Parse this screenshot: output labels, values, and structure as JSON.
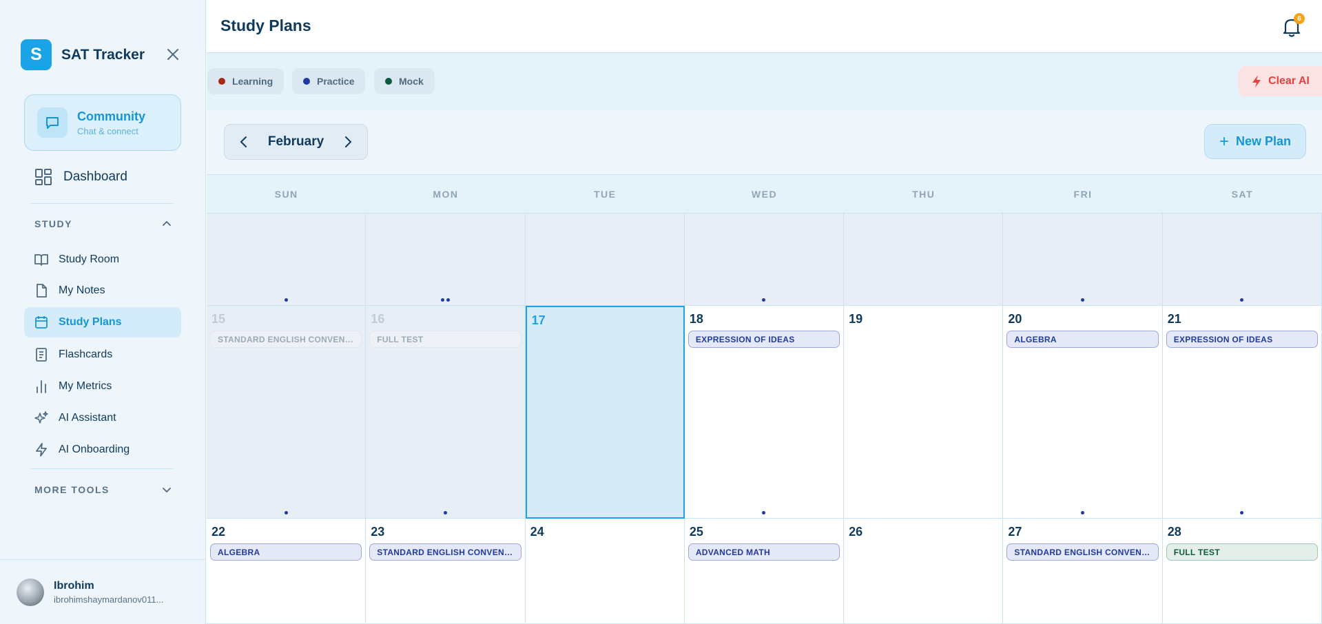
{
  "app": {
    "logo_letter": "S",
    "name": "SAT Tracker"
  },
  "sidebar": {
    "community": {
      "title": "Community",
      "subtitle": "Chat & connect"
    },
    "dashboard": "Dashboard",
    "study_section": "STUDY",
    "items": [
      {
        "label": "Study Room",
        "icon": "book-open-icon"
      },
      {
        "label": "My Notes",
        "icon": "file-icon"
      },
      {
        "label": "Study Plans",
        "icon": "calendar-icon",
        "active": true
      },
      {
        "label": "Flashcards",
        "icon": "notebook-icon"
      },
      {
        "label": "My Metrics",
        "icon": "bar-chart-icon"
      },
      {
        "label": "AI Assistant",
        "icon": "sparkles-icon"
      },
      {
        "label": "AI Onboarding",
        "icon": "lightning-icon"
      }
    ],
    "more_tools": "MORE TOOLS"
  },
  "user": {
    "name": "Ibrohim",
    "email": "ibrohimshaymardanov011..."
  },
  "header": {
    "title": "Study Plans",
    "notification_count": "6"
  },
  "legend": [
    {
      "label": "Learning",
      "color": "#a52a14"
    },
    {
      "label": "Practice",
      "color": "#1f3aa3"
    },
    {
      "label": "Mock",
      "color": "#0e5a3c"
    }
  ],
  "clear_ai": "Clear AI",
  "calendar": {
    "month": "February",
    "new_plan": "New Plan",
    "weekdays": [
      "SUN",
      "MON",
      "TUE",
      "WED",
      "THU",
      "FRI",
      "SAT"
    ],
    "weeks": [
      [
        {
          "day": "",
          "past": true,
          "dots": 1
        },
        {
          "day": "",
          "past": true,
          "dots": 2
        },
        {
          "day": "",
          "past": true,
          "dots": 0
        },
        {
          "day": "",
          "past": true,
          "dots": 1
        },
        {
          "day": "",
          "past": true,
          "dots": 0
        },
        {
          "day": "",
          "past": true,
          "dots": 1
        },
        {
          "day": "",
          "past": true,
          "dots": 1
        }
      ],
      [
        {
          "day": "15",
          "past": true,
          "event": "STANDARD ENGLISH CONVENTIONS",
          "type": "practice",
          "dots": 1
        },
        {
          "day": "16",
          "past": true,
          "event": "FULL TEST",
          "type": "mock",
          "dots": 1
        },
        {
          "day": "17",
          "today": true,
          "dots": 0
        },
        {
          "day": "18",
          "event": "EXPRESSION OF IDEAS",
          "type": "practice",
          "dots": 1
        },
        {
          "day": "19",
          "dots": 0
        },
        {
          "day": "20",
          "event": "ALGEBRA",
          "type": "practice",
          "dots": 1
        },
        {
          "day": "21",
          "event": "EXPRESSION OF IDEAS",
          "type": "practice",
          "dots": 1
        }
      ],
      [
        {
          "day": "22",
          "event": "ALGEBRA",
          "type": "practice",
          "dots": 0
        },
        {
          "day": "23",
          "event": "STANDARD ENGLISH CONVENTIONS",
          "type": "practice",
          "dots": 0
        },
        {
          "day": "24",
          "dots": 0
        },
        {
          "day": "25",
          "event": "ADVANCED MATH",
          "type": "practice",
          "dots": 0
        },
        {
          "day": "26",
          "dots": 0
        },
        {
          "day": "27",
          "event": "STANDARD ENGLISH CONVENTIONS",
          "type": "practice",
          "dots": 0
        },
        {
          "day": "28",
          "event": "FULL TEST",
          "type": "mock",
          "dots": 0
        }
      ]
    ]
  }
}
